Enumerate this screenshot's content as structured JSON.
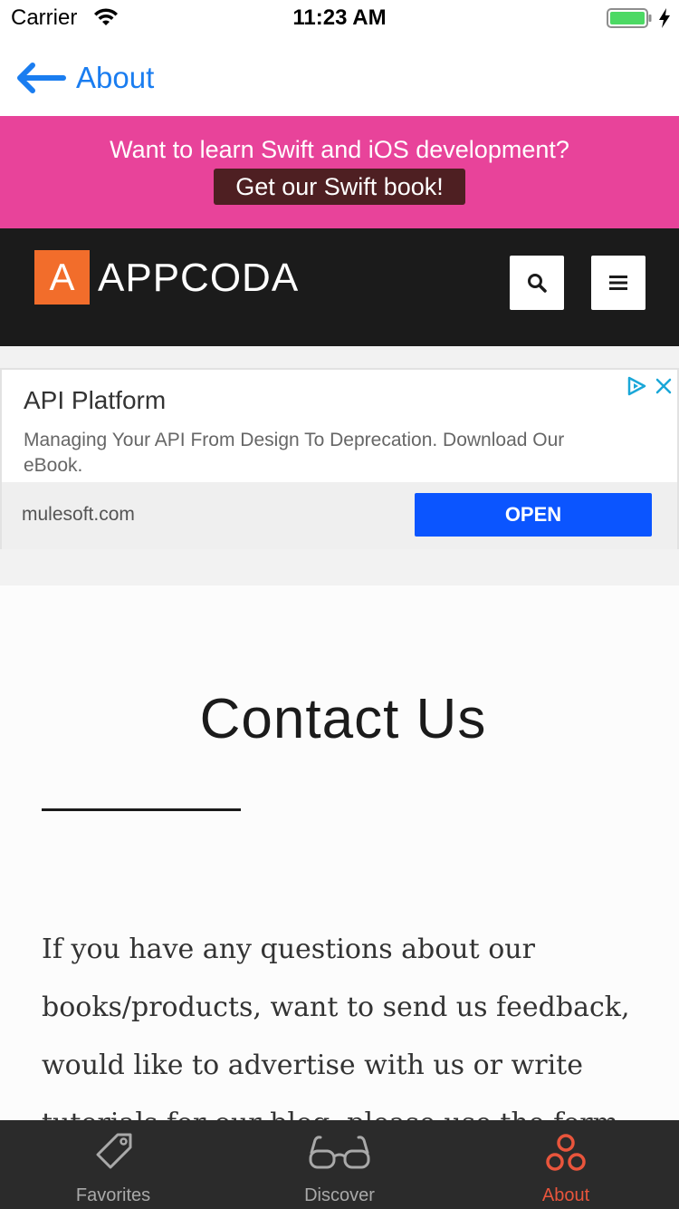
{
  "status_bar": {
    "carrier": "Carrier",
    "time": "11:23 AM",
    "battery_level": 1.0,
    "charging": true
  },
  "nav": {
    "back_label": "About",
    "tint_color": "#1a7df0"
  },
  "promo": {
    "text": "Want to learn Swift and iOS development?",
    "button_label": "Get our Swift book!",
    "background": "#e8439a"
  },
  "site_header": {
    "logo_mark": "A",
    "logo_text": "APPCODA",
    "accent": "#f26d2b",
    "buttons": [
      "search-icon",
      "menu-icon"
    ]
  },
  "ad": {
    "title": "API Platform",
    "description": "Managing Your API From Design To Deprecation. Download Our eBook.",
    "domain": "mulesoft.com",
    "cta": "OPEN",
    "cta_color": "#0b55ff"
  },
  "contact": {
    "title": "Contact Us",
    "body": "If you have any questions about our books/products, want to send us feedback, would like to advertise with us or write tutorials for our blog, please use the form"
  },
  "tab_bar": {
    "tabs": [
      {
        "label": "Favorites",
        "icon": "tag-icon",
        "active": false
      },
      {
        "label": "Discover",
        "icon": "glasses-icon",
        "active": false
      },
      {
        "label": "About",
        "icon": "circles-icon",
        "active": true
      }
    ],
    "active_color": "#e9553c"
  }
}
